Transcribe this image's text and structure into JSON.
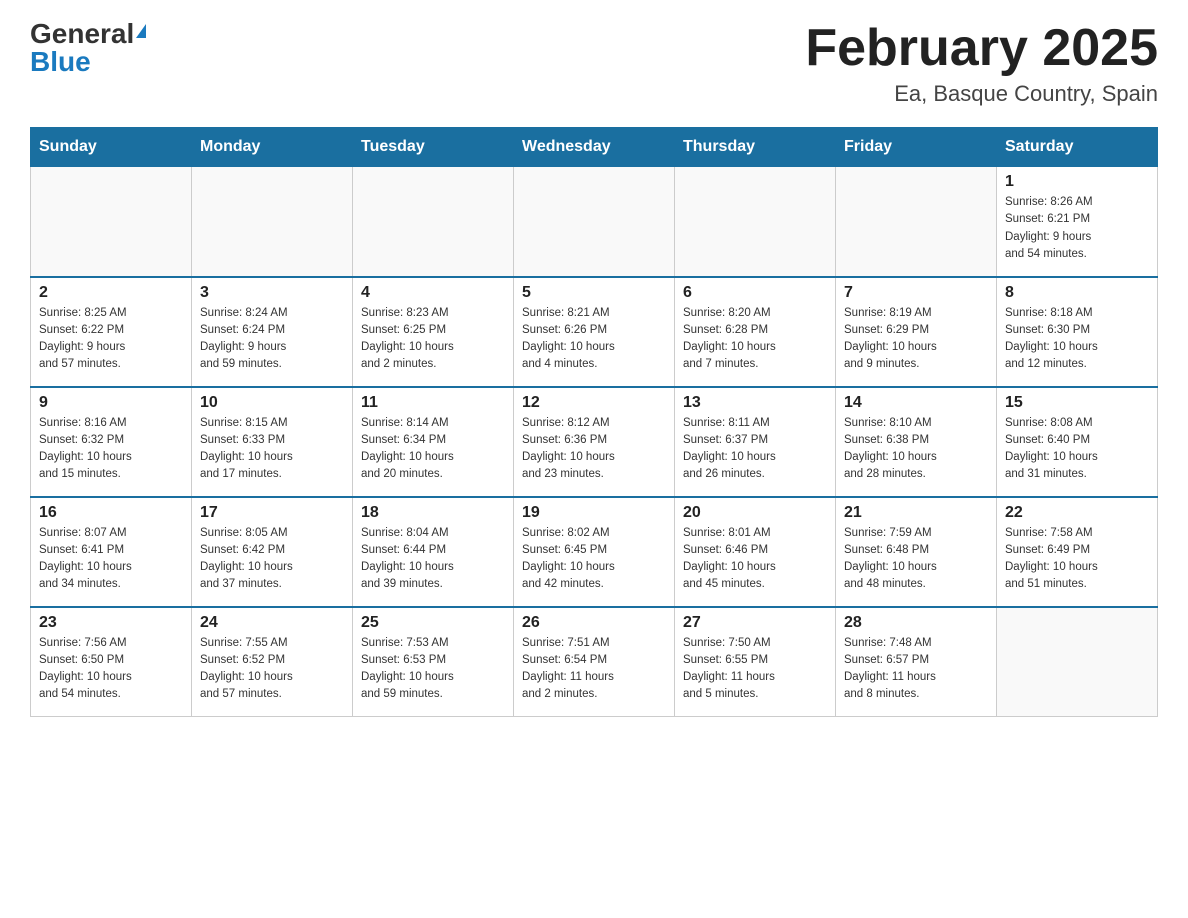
{
  "header": {
    "logo_general": "General",
    "logo_blue": "Blue",
    "month_title": "February 2025",
    "location": "Ea, Basque Country, Spain"
  },
  "weekdays": [
    "Sunday",
    "Monday",
    "Tuesday",
    "Wednesday",
    "Thursday",
    "Friday",
    "Saturday"
  ],
  "weeks": [
    [
      {
        "day": "",
        "info": ""
      },
      {
        "day": "",
        "info": ""
      },
      {
        "day": "",
        "info": ""
      },
      {
        "day": "",
        "info": ""
      },
      {
        "day": "",
        "info": ""
      },
      {
        "day": "",
        "info": ""
      },
      {
        "day": "1",
        "info": "Sunrise: 8:26 AM\nSunset: 6:21 PM\nDaylight: 9 hours\nand 54 minutes."
      }
    ],
    [
      {
        "day": "2",
        "info": "Sunrise: 8:25 AM\nSunset: 6:22 PM\nDaylight: 9 hours\nand 57 minutes."
      },
      {
        "day": "3",
        "info": "Sunrise: 8:24 AM\nSunset: 6:24 PM\nDaylight: 9 hours\nand 59 minutes."
      },
      {
        "day": "4",
        "info": "Sunrise: 8:23 AM\nSunset: 6:25 PM\nDaylight: 10 hours\nand 2 minutes."
      },
      {
        "day": "5",
        "info": "Sunrise: 8:21 AM\nSunset: 6:26 PM\nDaylight: 10 hours\nand 4 minutes."
      },
      {
        "day": "6",
        "info": "Sunrise: 8:20 AM\nSunset: 6:28 PM\nDaylight: 10 hours\nand 7 minutes."
      },
      {
        "day": "7",
        "info": "Sunrise: 8:19 AM\nSunset: 6:29 PM\nDaylight: 10 hours\nand 9 minutes."
      },
      {
        "day": "8",
        "info": "Sunrise: 8:18 AM\nSunset: 6:30 PM\nDaylight: 10 hours\nand 12 minutes."
      }
    ],
    [
      {
        "day": "9",
        "info": "Sunrise: 8:16 AM\nSunset: 6:32 PM\nDaylight: 10 hours\nand 15 minutes."
      },
      {
        "day": "10",
        "info": "Sunrise: 8:15 AM\nSunset: 6:33 PM\nDaylight: 10 hours\nand 17 minutes."
      },
      {
        "day": "11",
        "info": "Sunrise: 8:14 AM\nSunset: 6:34 PM\nDaylight: 10 hours\nand 20 minutes."
      },
      {
        "day": "12",
        "info": "Sunrise: 8:12 AM\nSunset: 6:36 PM\nDaylight: 10 hours\nand 23 minutes."
      },
      {
        "day": "13",
        "info": "Sunrise: 8:11 AM\nSunset: 6:37 PM\nDaylight: 10 hours\nand 26 minutes."
      },
      {
        "day": "14",
        "info": "Sunrise: 8:10 AM\nSunset: 6:38 PM\nDaylight: 10 hours\nand 28 minutes."
      },
      {
        "day": "15",
        "info": "Sunrise: 8:08 AM\nSunset: 6:40 PM\nDaylight: 10 hours\nand 31 minutes."
      }
    ],
    [
      {
        "day": "16",
        "info": "Sunrise: 8:07 AM\nSunset: 6:41 PM\nDaylight: 10 hours\nand 34 minutes."
      },
      {
        "day": "17",
        "info": "Sunrise: 8:05 AM\nSunset: 6:42 PM\nDaylight: 10 hours\nand 37 minutes."
      },
      {
        "day": "18",
        "info": "Sunrise: 8:04 AM\nSunset: 6:44 PM\nDaylight: 10 hours\nand 39 minutes."
      },
      {
        "day": "19",
        "info": "Sunrise: 8:02 AM\nSunset: 6:45 PM\nDaylight: 10 hours\nand 42 minutes."
      },
      {
        "day": "20",
        "info": "Sunrise: 8:01 AM\nSunset: 6:46 PM\nDaylight: 10 hours\nand 45 minutes."
      },
      {
        "day": "21",
        "info": "Sunrise: 7:59 AM\nSunset: 6:48 PM\nDaylight: 10 hours\nand 48 minutes."
      },
      {
        "day": "22",
        "info": "Sunrise: 7:58 AM\nSunset: 6:49 PM\nDaylight: 10 hours\nand 51 minutes."
      }
    ],
    [
      {
        "day": "23",
        "info": "Sunrise: 7:56 AM\nSunset: 6:50 PM\nDaylight: 10 hours\nand 54 minutes."
      },
      {
        "day": "24",
        "info": "Sunrise: 7:55 AM\nSunset: 6:52 PM\nDaylight: 10 hours\nand 57 minutes."
      },
      {
        "day": "25",
        "info": "Sunrise: 7:53 AM\nSunset: 6:53 PM\nDaylight: 10 hours\nand 59 minutes."
      },
      {
        "day": "26",
        "info": "Sunrise: 7:51 AM\nSunset: 6:54 PM\nDaylight: 11 hours\nand 2 minutes."
      },
      {
        "day": "27",
        "info": "Sunrise: 7:50 AM\nSunset: 6:55 PM\nDaylight: 11 hours\nand 5 minutes."
      },
      {
        "day": "28",
        "info": "Sunrise: 7:48 AM\nSunset: 6:57 PM\nDaylight: 11 hours\nand 8 minutes."
      },
      {
        "day": "",
        "info": ""
      }
    ]
  ]
}
